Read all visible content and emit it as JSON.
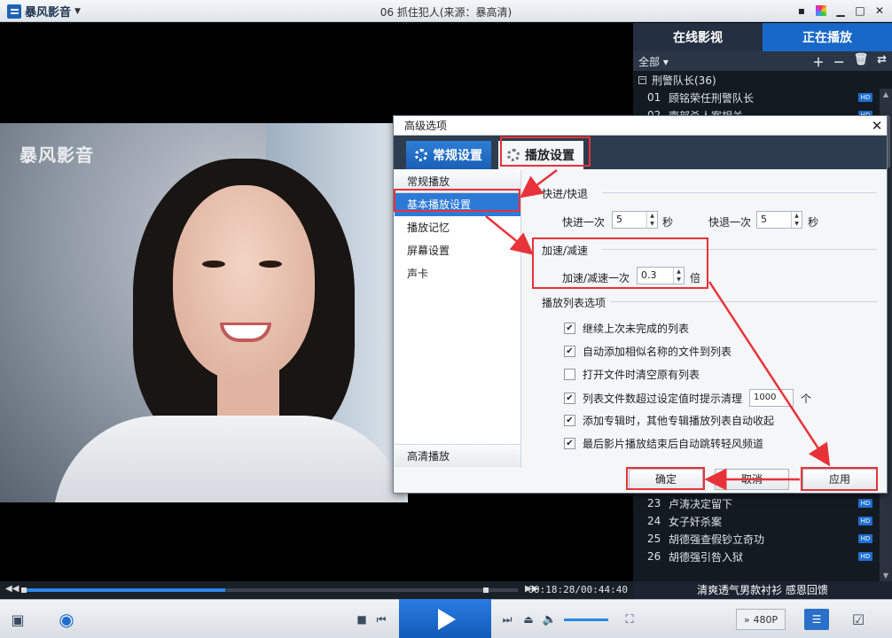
{
  "app": {
    "name": "暴风影音",
    "window_title": "06 抓住犯人(来源：暴高清)"
  },
  "video": {
    "watermark": "暴风影音"
  },
  "panel": {
    "tabs": [
      "在线影视",
      "正在播放"
    ],
    "filter_label": "全部",
    "group": "刑警队长(36)",
    "items_top": [
      {
        "num": "01",
        "title": "顾铭荣任刑警队长",
        "badge": "HD"
      },
      {
        "num": "02",
        "title": "南部杀人案相关",
        "badge": "HD"
      }
    ],
    "items_bottom": [
      {
        "num": "23",
        "title": "卢涛决定留下",
        "badge": "HD"
      },
      {
        "num": "24",
        "title": "女子奸杀案",
        "badge": "HD"
      },
      {
        "num": "25",
        "title": "胡德强查假钞立奇功",
        "badge": "HD"
      },
      {
        "num": "26",
        "title": "胡德强引咎入狱",
        "badge": "HD"
      }
    ],
    "ad_text": "清爽透气男款衬衫 感恩回馈"
  },
  "seek": {
    "time": "00:18:28/00:44:40",
    "progress": 0.41,
    "buffer_marker": 0.93
  },
  "controls": {
    "resolution": "480P",
    "volume": 0.8
  },
  "dialog": {
    "title": "高级选项",
    "tab_general": "常规设置",
    "tab_playback": "播放设置",
    "sidebar_header": "常规播放",
    "sidebar_items": [
      "基本播放设置",
      "播放记忆",
      "屏幕设置",
      "声卡"
    ],
    "sidebar_bottom": "高清播放",
    "section_seek": "快进/快退",
    "forward_label": "快进一次",
    "forward_value": "5",
    "backward_label": "快退一次",
    "backward_value": "5",
    "seconds_unit": "秒",
    "section_speed": "加速/减速",
    "speed_label": "加速/减速一次",
    "speed_value": "0.3",
    "speed_unit": "倍",
    "section_playlist": "播放列表选项",
    "options": [
      {
        "label": "继续上次未完成的列表",
        "checked": "✔"
      },
      {
        "label": "自动添加相似名称的文件到列表",
        "checked": "✔"
      },
      {
        "label": "打开文件时清空原有列表",
        "checked": ""
      },
      {
        "label": "列表文件数超过设定值时提示清理",
        "checked": "✔"
      },
      {
        "label": "添加专辑时，其他专辑播放列表自动收起",
        "checked": "✔"
      },
      {
        "label": "最后影片播放结束后自动跳转轻风频道",
        "checked": "✔"
      }
    ],
    "limit_value": "1000",
    "limit_unit": "个",
    "ok": "确定",
    "cancel": "取消",
    "apply": "应用"
  }
}
